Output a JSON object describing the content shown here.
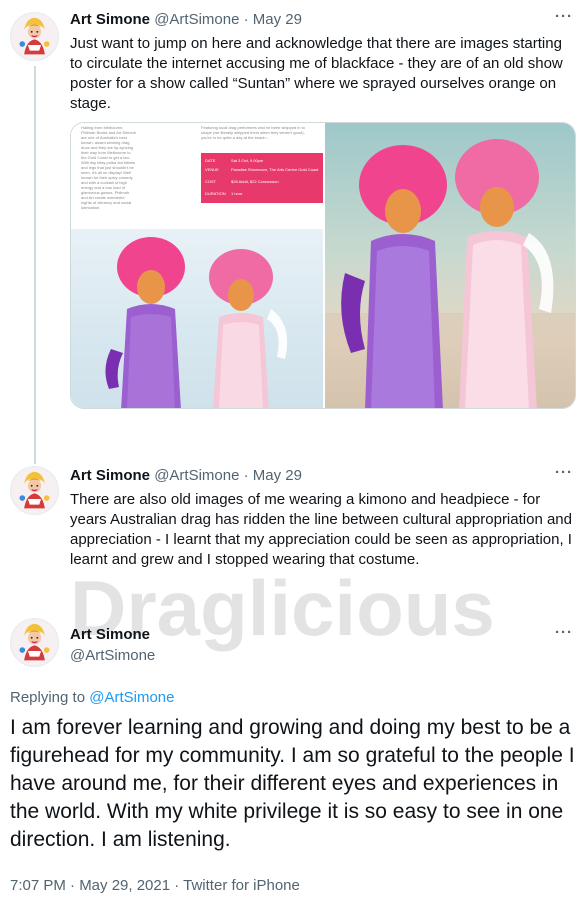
{
  "tweets": [
    {
      "name": "Art Simone",
      "handle": "@ArtSimone",
      "separator": "·",
      "date": "May 29",
      "more": "···",
      "text": "Just want to jump on here and acknowledge that there are images starting to circulate the internet accusing me of blackface - they are of an old show poster for a show called “Suntan” where we sprayed ourselves orange on stage.",
      "poster": {
        "col1": "Hailing from Melbourne, Philmah Bucks and Art Simone are one of Australia's best known, award winning drag duos and they are lip-syncing their way from Melbourne to the Gold Coast to get a tan. With itsy bitsy polka dot bikinis and legs that just shouldn't be seen, it's all on display! Well known for their spicy comedy and with a cocktail of high energy and a bus load of glamorous gowns, Philmah and Art create wonderful nights of vibrancy and social lubrication.",
        "col2": "Featuring local drag performers who've been whipped in to shape (we literally whipped them when they weren't good), you're in for quite a day at the beach…",
        "info_rows": [
          {
            "label": "DATE",
            "value": "Sat 3 Oct, 9.00pm"
          },
          {
            "label": "VENUE",
            "value": "Paradise Showroom, The Arts Centre Gold Coast"
          },
          {
            "label": "COST",
            "value": "$28 Adult, $22 Concession"
          },
          {
            "label": "DURATION",
            "value": "1 hour"
          }
        ]
      }
    },
    {
      "name": "Art Simone",
      "handle": "@ArtSimone",
      "separator": "·",
      "date": "May 29",
      "more": "···",
      "text": "There are also old images of me wearing a kimono and headpiece - for years Australian drag has ridden the line between cultural appropriation and appreciation - I learnt that my appreciation could be seen as appropriation, I learnt and grew and I stopped wearing that costume."
    }
  ],
  "main_tweet": {
    "name": "Art Simone",
    "handle": "@ArtSimone",
    "more": "···",
    "replying_prefix": "Replying to",
    "replying_to": "@ArtSimone",
    "text": "I am forever learning and growing and doing my best to be a figurehead for my community. I am so grateful to the people I have around me, for their different eyes and experiences in the world. With my white privilege it is so easy to see in one direction. I am listening.",
    "footer": "7:07 PM · May 29, 2021 · Twitter for iPhone"
  },
  "watermark": "Draglicious",
  "colors": {
    "text": "#0f1419",
    "secondary": "#536471",
    "link": "#1d9bf0",
    "thread_line": "#cfd9de",
    "poster_pink": "#e83a6a"
  },
  "icons": [
    "avatar-drag-queen",
    "more-dots-icon"
  ]
}
